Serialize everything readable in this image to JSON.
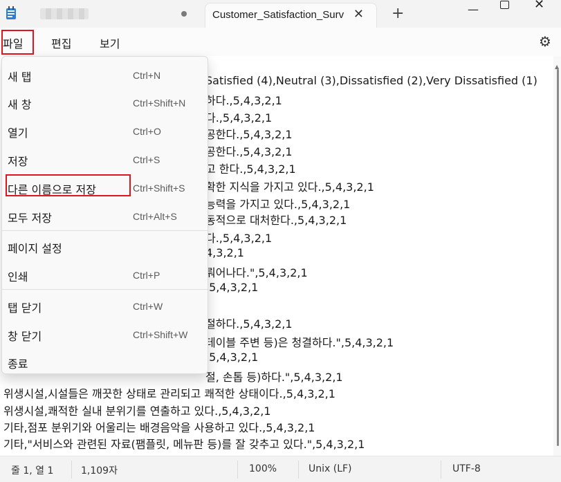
{
  "titlebar": {
    "tab_title": "Customer_Satisfaction_Surv",
    "close_tab_glyph": "✕",
    "new_tab_glyph": "+",
    "minimize_glyph": "—",
    "close_glyph": "✕"
  },
  "menubar": {
    "file": "파일",
    "edit": "편집",
    "view": "보기",
    "settings_glyph": "⚙"
  },
  "editor": {
    "visible_fragments": [
      "Satisfied (4),Neutral (3),Dissatisfied (2),Very Dissatisfied (1)",
      "하다.,5,4,3,2,1",
      "다.,5,4,3,2,1",
      "공한다.,5,4,3,2,1",
      "공한다.,5,4,3,2,1",
      "고 한다.,5,4,3,2,1",
      "확한 지식을 가지고 있다.,5,4,3,2,1",
      "능력을 가지고 있다.,5,4,3,2,1",
      "동적으로 대처한다.,5,4,3,2,1",
      "다.,5,4,3,2,1",
      "4,3,2,1",
      "뤄어나다.\",5,4,3,2,1",
      ",5,4,3,2,1",
      "",
      "절하다.,5,4,3,2,1",
      "테이블 주변 등)은 청결하다.\",5,4,3,2,1",
      ",5,4,3,2,1",
      "절, 손톱 등)하다.\",5,4,3,2,1"
    ],
    "full_lines": [
      "위생시설,시설들은 깨끗한 상태로 관리되고 쾌적한 상태이다.,5,4,3,2,1",
      "위생시설,쾌적한 실내 분위기를 연출하고 있다.,5,4,3,2,1",
      "기타,점포 분위기와 어울리는 배경음악을 사용하고 있다.,5,4,3,2,1",
      "기타,\"서비스와 관련된 자료(팸플릿, 메뉴판 등)를 잘 갖추고 있다.\",5,4,3,2,1"
    ]
  },
  "file_menu": {
    "items": [
      {
        "label": "새 탭",
        "shortcut": "Ctrl+N"
      },
      {
        "label": "새 창",
        "shortcut": "Ctrl+Shift+N"
      },
      {
        "label": "열기",
        "shortcut": "Ctrl+O"
      },
      {
        "label": "저장",
        "shortcut": "Ctrl+S"
      },
      {
        "label": "다른 이름으로 저장",
        "shortcut": "Ctrl+Shift+S"
      },
      {
        "label": "모두 저장",
        "shortcut": "Ctrl+Alt+S"
      },
      {
        "label": "페이지 설정",
        "shortcut": ""
      },
      {
        "label": "인쇄",
        "shortcut": "Ctrl+P"
      },
      {
        "label": "탭 닫기",
        "shortcut": "Ctrl+W"
      },
      {
        "label": "창 닫기",
        "shortcut": "Ctrl+Shift+W"
      },
      {
        "label": "종료",
        "shortcut": ""
      }
    ]
  },
  "statusbar": {
    "position": "줄 1, 열 1",
    "char_count": "1,109자",
    "zoom": "100%",
    "line_ending": "Unix (LF)",
    "encoding": "UTF-8"
  },
  "colors": {
    "highlight_box": "#e0141c",
    "titlebar_bg": "#f3f3f3",
    "menu_bg": "#f9f9f9"
  }
}
